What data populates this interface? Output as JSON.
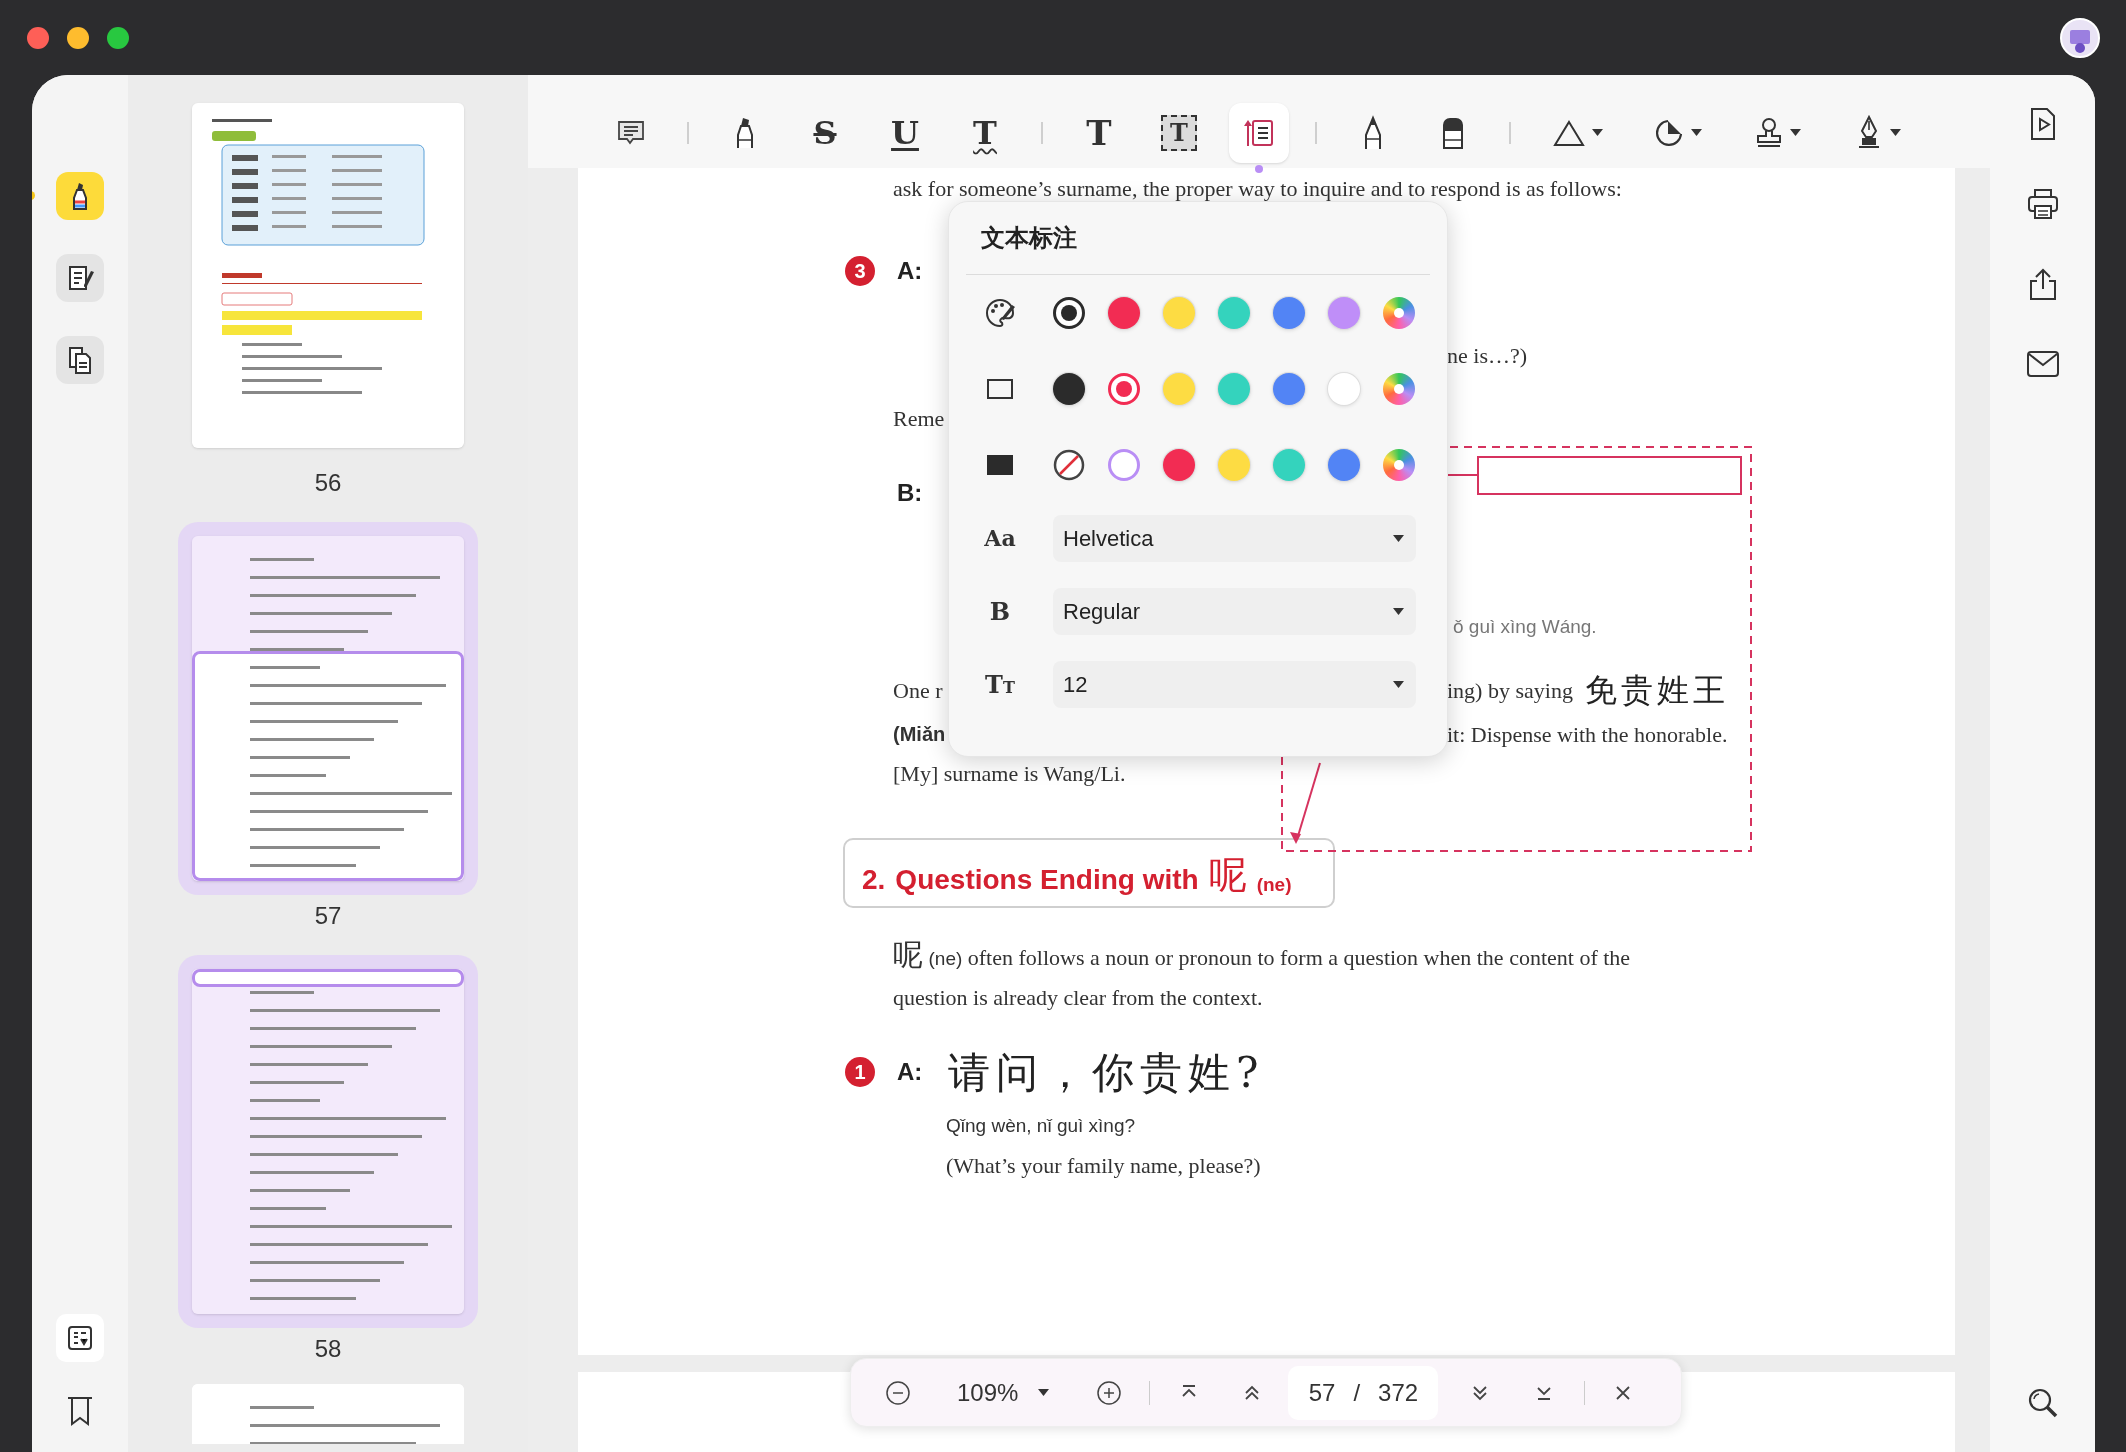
{
  "left_rail": {
    "items": [
      {
        "kind": "highlight",
        "selected": true
      },
      {
        "kind": "edit",
        "selected": false
      },
      {
        "kind": "pages",
        "selected": false
      }
    ],
    "bottom_items": [
      {
        "kind": "form"
      },
      {
        "kind": "bookmark"
      }
    ]
  },
  "thumbnails": [
    {
      "kind": "page",
      "label": "56",
      "in_view": false
    },
    {
      "kind": "viewport_lower",
      "label": "57",
      "in_view": true
    },
    {
      "kind": "viewport_top",
      "label": "58",
      "in_view": true
    }
  ],
  "toolbar": {
    "tools": [
      {
        "kind": "note",
        "selected": false
      },
      {
        "kind": "separator"
      },
      {
        "kind": "highlighter",
        "selected": false
      },
      {
        "kind": "strike",
        "glyph": "S",
        "selected": false
      },
      {
        "kind": "underline",
        "glyph": "U",
        "selected": false
      },
      {
        "kind": "squiggly",
        "glyph": "T",
        "selected": false
      },
      {
        "kind": "separator"
      },
      {
        "kind": "text",
        "glyph": "T",
        "selected": false
      },
      {
        "kind": "textbox",
        "glyph": "T",
        "selected": false
      },
      {
        "kind": "callout",
        "selected": true
      },
      {
        "kind": "separator"
      },
      {
        "kind": "pencil",
        "selected": false
      },
      {
        "kind": "eraser",
        "selected": false
      },
      {
        "kind": "separator"
      },
      {
        "kind": "shape",
        "selected": false
      },
      {
        "kind": "sticker",
        "selected": false
      },
      {
        "kind": "stamp",
        "selected": false
      },
      {
        "kind": "signature",
        "selected": false
      }
    ]
  },
  "document": {
    "blocks": [
      {
        "kind": "line",
        "text": "ask for someone’s surname, the proper way to inquire and to respond is as follows:"
      },
      {
        "kind": "speaker",
        "badge": "3",
        "speaker": "A:"
      },
      {
        "kind": "split",
        "right": "ne is…?)"
      },
      {
        "kind": "split",
        "left": "Reme"
      },
      {
        "kind": "speaker",
        "speaker": "B:"
      },
      {
        "kind": "split_pinyin",
        "right": "ǒ guì xìng Wáng."
      },
      {
        "kind": "split",
        "left": "One r",
        "right": "ing) by saying",
        "right_cjk": "免贵姓王"
      },
      {
        "kind": "split_label",
        "left": "(Miǎn",
        "right": "it: Dispense with the honorable."
      },
      {
        "kind": "split",
        "left": "[My] surname is Wang/Li."
      },
      {
        "kind": "heading",
        "number": "2.",
        "text": "Questions Ending with",
        "cjk": "呢",
        "pinyin": "(ne)"
      },
      {
        "kind": "paragraph",
        "cjk": "呢",
        "pinyin": "(ne)",
        "text": "often follows a noun or pronoun to form a question when the content of the question is already clear from the context."
      },
      {
        "kind": "speaker",
        "badge": "1",
        "speaker": "A:",
        "cjk": "请问，你贵姓?"
      },
      {
        "kind": "pinyin",
        "text": "Qǐng wèn, nǐ guì xìng?"
      },
      {
        "kind": "translation",
        "text": "(What’s your family name, please?)"
      }
    ]
  },
  "popup": {
    "title": "文本标注",
    "swatch_rows": [
      {
        "kind": "text_color",
        "swatches": [
          {
            "kind": "color",
            "color": "#2b2b2b",
            "selected": true
          },
          {
            "kind": "color",
            "color": "#f22c53",
            "selected": false
          },
          {
            "kind": "color",
            "color": "#fddc43",
            "selected": false
          },
          {
            "kind": "color",
            "color": "#34d3bd",
            "selected": false
          },
          {
            "kind": "color",
            "color": "#5284f5",
            "selected": false
          },
          {
            "kind": "color",
            "color": "#bf8ef8",
            "selected": false
          },
          {
            "kind": "picker",
            "selected": false
          }
        ]
      },
      {
        "kind": "border",
        "swatches": [
          {
            "kind": "color",
            "color": "#2b2b2b",
            "selected": false
          },
          {
            "kind": "color",
            "color": "#f22c53",
            "selected": true
          },
          {
            "kind": "color",
            "color": "#fddc43",
            "selected": false
          },
          {
            "kind": "color",
            "color": "#34d3bd",
            "selected": false
          },
          {
            "kind": "color",
            "color": "#5284f5",
            "selected": false
          },
          {
            "kind": "color",
            "color": "#ffffff",
            "selected": false
          },
          {
            "kind": "picker",
            "selected": false
          }
        ]
      },
      {
        "kind": "fill",
        "swatches": [
          {
            "kind": "none",
            "selected": false
          },
          {
            "kind": "color",
            "color": "#ffffff",
            "selected": true
          },
          {
            "kind": "color",
            "color": "#f22c53",
            "selected": false
          },
          {
            "kind": "color",
            "color": "#fddc43",
            "selected": false
          },
          {
            "kind": "color",
            "color": "#34d3bd",
            "selected": false
          },
          {
            "kind": "color",
            "color": "#5284f5",
            "selected": false
          },
          {
            "kind": "picker",
            "selected": false
          }
        ]
      }
    ],
    "dropdowns": [
      {
        "kind": "font",
        "icon": "Aa",
        "value": "Helvetica"
      },
      {
        "kind": "weight",
        "icon": "B",
        "value": "Regular"
      },
      {
        "kind": "size",
        "icon": "TT",
        "value": "12"
      }
    ]
  },
  "bottom_bar": {
    "zoom": "109%",
    "page": "57",
    "separator": "/",
    "total": "372"
  },
  "right_rail": {
    "items": [
      {
        "kind": "slideshow"
      },
      {
        "kind": "print"
      },
      {
        "kind": "share"
      },
      {
        "kind": "mail"
      }
    ],
    "bottom_items": [
      {
        "kind": "search"
      }
    ]
  }
}
